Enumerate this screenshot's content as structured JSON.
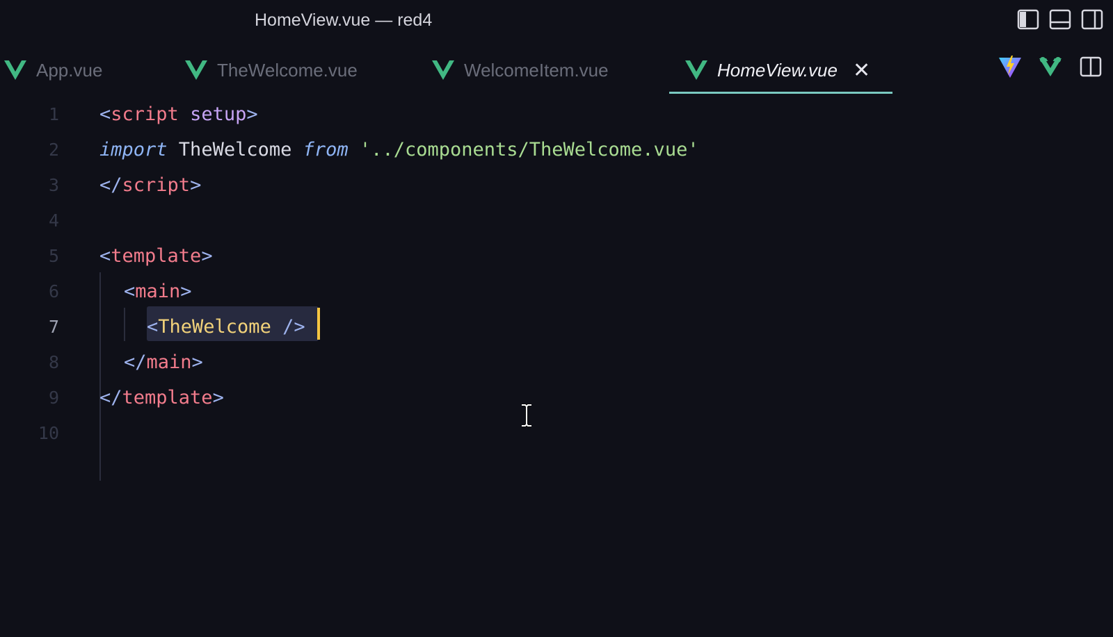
{
  "window": {
    "title": "HomeView.vue — red4"
  },
  "layout_controls": [
    {
      "icon": "toggle-primary-sidebar-icon"
    },
    {
      "icon": "toggle-panel-icon"
    },
    {
      "icon": "toggle-secondary-sidebar-icon"
    }
  ],
  "tabs": [
    {
      "label": "App.vue",
      "active": false
    },
    {
      "label": "TheWelcome.vue",
      "active": false
    },
    {
      "label": "WelcomeItem.vue",
      "active": false
    },
    {
      "label": "HomeView.vue",
      "active": true,
      "close": "✕"
    }
  ],
  "tab_actions": [
    {
      "icon": "vite-icon"
    },
    {
      "icon": "vue-devtools-icon"
    },
    {
      "icon": "split-editor-icon"
    }
  ],
  "editor": {
    "current_line": 7,
    "lines": [
      {
        "n": "1",
        "tokens": {
          "a": "<",
          "b": "script",
          "c": " ",
          "d": "setup",
          "e": ">"
        }
      },
      {
        "n": "2",
        "tokens": {
          "a": "import",
          "b": " TheWelcome ",
          "c": "from",
          "d": " ",
          "e": "'../components/TheWelcome.vue'"
        }
      },
      {
        "n": "3",
        "tokens": {
          "a": "</",
          "b": "script",
          "c": ">"
        }
      },
      {
        "n": "4"
      },
      {
        "n": "5",
        "tokens": {
          "a": "<",
          "b": "template",
          "c": ">"
        }
      },
      {
        "n": "6",
        "tokens": {
          "a": "<",
          "b": "main",
          "c": ">"
        }
      },
      {
        "n": "7",
        "tokens": {
          "a": "<",
          "b": "TheWelcome",
          "c": " />"
        }
      },
      {
        "n": "8",
        "tokens": {
          "a": "</",
          "b": "main",
          "c": ">"
        }
      },
      {
        "n": "9",
        "tokens": {
          "a": "</",
          "b": "template",
          "c": ">"
        }
      },
      {
        "n": "10"
      }
    ]
  },
  "colors": {
    "background": "#0f1018",
    "tab_active_underline": "#7ac9c0",
    "vue_green": "#41b883",
    "tag": "#f27c8c",
    "string": "#a9dc92",
    "component": "#f2d27a",
    "caret": "#f5c542"
  }
}
